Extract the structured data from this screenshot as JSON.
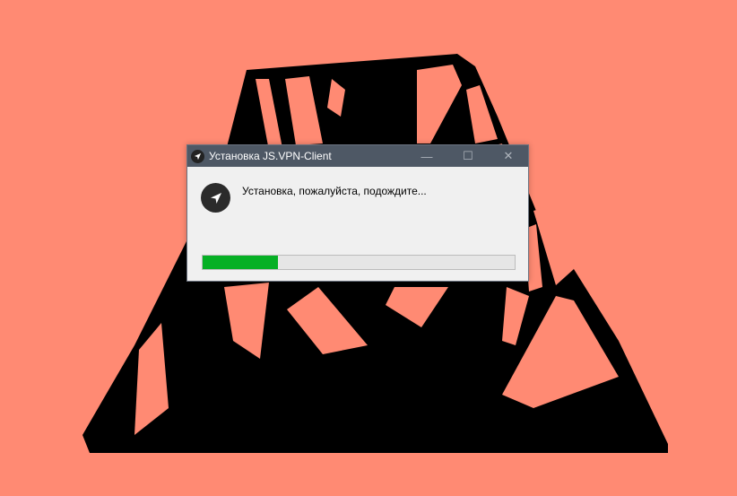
{
  "window": {
    "title": "Установка JS.VPN-Client",
    "controls": {
      "minimize": "—",
      "maximize": "☐",
      "close": "✕"
    }
  },
  "content": {
    "status": "Установка, пожалуйста, подождите...",
    "progress_fraction": 0.24
  },
  "icons": {
    "title": "navigation-arrow-icon",
    "app": "navigation-arrow-icon"
  },
  "colors": {
    "desktop_background": "#ff8a73",
    "titlebar": "#4e5865",
    "progress_fill": "#06b025"
  }
}
